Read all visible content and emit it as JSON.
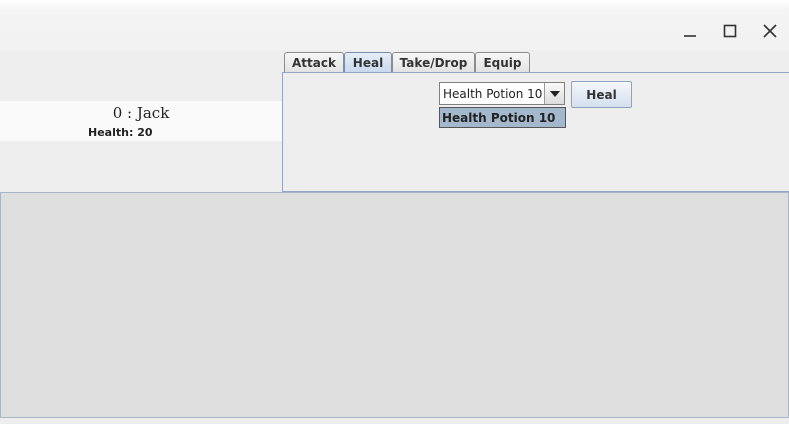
{
  "window": {
    "controls": [
      {
        "icon": "minimize-icon"
      },
      {
        "icon": "maximize-icon"
      },
      {
        "icon": "close-icon"
      }
    ]
  },
  "player": {
    "name": "0 : Jack",
    "health_label": "Health:",
    "health_value": "20"
  },
  "tabs": [
    {
      "label": "Attack",
      "active": false
    },
    {
      "label": "Heal",
      "active": true
    },
    {
      "label": "Take/Drop",
      "active": false
    },
    {
      "label": "Equip",
      "active": false
    }
  ],
  "heal_panel": {
    "item_select": {
      "selected": "Health Potion 10",
      "options": [
        "Health Potion 10"
      ]
    },
    "heal_button_label": "Heal"
  },
  "colors": {
    "active_tab": "#c8d8ee",
    "dropdown_highlight": "#a3b8cc",
    "log_background": "#dedede"
  }
}
